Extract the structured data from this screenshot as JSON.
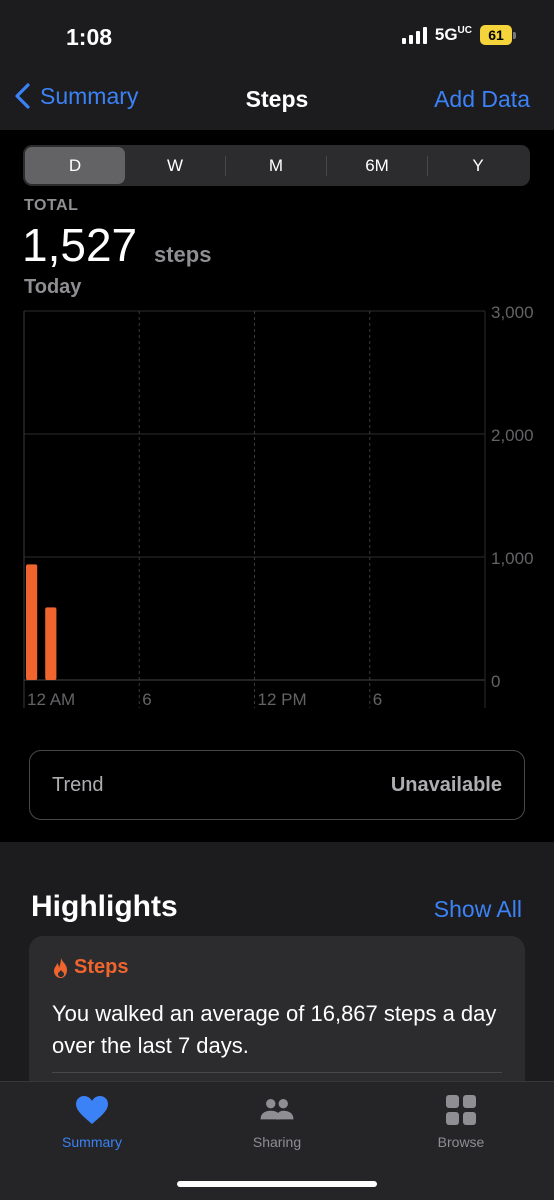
{
  "status_bar": {
    "time": "1:08",
    "network": "5G",
    "network_suffix": "UC",
    "battery": "61",
    "icons": [
      "signal-icon",
      "battery-icon"
    ]
  },
  "nav": {
    "back_label": "Summary",
    "title": "Steps",
    "action_label": "Add Data"
  },
  "segments": [
    {
      "label": "D",
      "active": true
    },
    {
      "label": "W",
      "active": false
    },
    {
      "label": "M",
      "active": false
    },
    {
      "label": "6M",
      "active": false
    },
    {
      "label": "Y",
      "active": false
    }
  ],
  "summary": {
    "label": "TOTAL",
    "value": "1,527",
    "unit": "steps",
    "date": "Today"
  },
  "chart_data": {
    "type": "bar",
    "bar_color": "#f0642e",
    "hours": [
      0,
      1
    ],
    "values": [
      940,
      590
    ],
    "x_ticks": [
      "12 AM",
      "6",
      "12 PM",
      "6"
    ],
    "y_ticks": [
      "3,000",
      "2,000",
      "1,000",
      "0"
    ],
    "ylim": [
      0,
      3000
    ],
    "grid": true
  },
  "trend": {
    "label": "Trend",
    "value": "Unavailable"
  },
  "highlights": {
    "title": "Highlights",
    "show_all": "Show All",
    "card": {
      "category": "Steps",
      "icon": "flame-icon",
      "text": "You walked an average of 16,867 steps a day over the last 7 days."
    }
  },
  "tabs": [
    {
      "label": "Summary",
      "icon": "heart-icon",
      "active": true
    },
    {
      "label": "Sharing",
      "icon": "people-icon",
      "active": false
    },
    {
      "label": "Browse",
      "icon": "grid-icon",
      "active": false
    }
  ],
  "colors": {
    "accent": "#3b82f6",
    "steps": "#f0642e"
  }
}
